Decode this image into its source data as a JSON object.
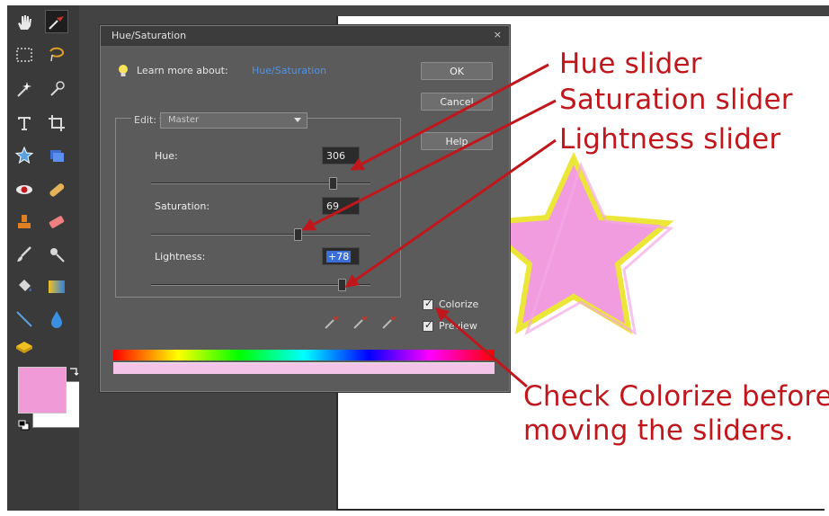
{
  "dialog": {
    "title": "Hue/Saturation",
    "close": "×",
    "learn_more": "Learn more about:",
    "learn_link": "Hue/Saturation",
    "ok": "OK",
    "cancel": "Cancel",
    "help": "Help",
    "edit_label": "Edit:",
    "edit_value": "Master",
    "hue": {
      "label": "Hue:",
      "value": "306"
    },
    "saturation": {
      "label": "Saturation:",
      "value": "69"
    },
    "lightness": {
      "label": "Lightness:",
      "value": "+78"
    },
    "colorize_label": "Colorize",
    "preview_label": "Preview"
  },
  "annotations": {
    "hue": "Hue slider",
    "saturation": "Saturation slider",
    "lightness": "Lightness slider",
    "note_line1": "Check Colorize before",
    "note_line2": "moving the sliders."
  },
  "colors": {
    "foreground": "#f09ad8",
    "star_fill": "#f29ce0",
    "star_outline": "#ece638",
    "annotation_red": "#c0171d"
  }
}
